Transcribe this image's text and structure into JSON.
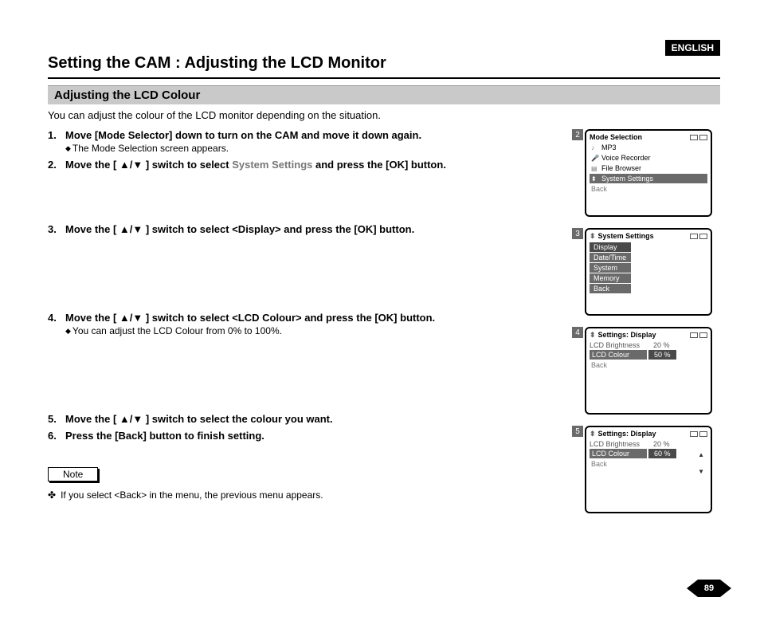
{
  "lang_tag": "ENGLISH",
  "page_title": "Setting the CAM : Adjusting the LCD Monitor",
  "section_title": "Adjusting the LCD Colour",
  "intro": "You can adjust the colour of the LCD monitor depending on the situation.",
  "steps": {
    "s1": {
      "num": "1.",
      "main": "Move [Mode Selector] down to turn on the CAM and move it down again.",
      "sub": "The Mode Selection screen appears."
    },
    "s2": {
      "num": "2.",
      "main_a": "Move the [ ▲/▼ ] switch to select ",
      "main_grey": "System Settings",
      "main_b": " and press the [OK] button."
    },
    "s3": {
      "num": "3.",
      "main": "Move the [ ▲/▼ ] switch to select <Display> and press the [OK] button."
    },
    "s4": {
      "num": "4.",
      "main": "Move the [ ▲/▼ ] switch to select <LCD Colour> and press the [OK] button.",
      "sub": "You can adjust the LCD Colour from 0% to 100%."
    },
    "s5": {
      "num": "5.",
      "main": "Move the [ ▲/▼ ] switch to select the colour you want."
    },
    "s6": {
      "num": "6.",
      "main": "Press the [Back] button to finish setting."
    }
  },
  "note_label": "Note",
  "note_text": "If you select <Back> in the menu, the previous menu appears.",
  "page_number": "89",
  "screens": {
    "scr2": {
      "num": "2",
      "title": "Mode Selection",
      "items": {
        "mp3": "MP3",
        "voice": "Voice Recorder",
        "file": "File Browser",
        "sys": "System Settings"
      },
      "back": "Back"
    },
    "scr3": {
      "num": "3",
      "title": "System Settings",
      "items": {
        "display": "Display",
        "datetime": "Date/Time",
        "system": "System",
        "memory": "Memory",
        "back": "Back"
      }
    },
    "scr4": {
      "num": "4",
      "title": "Settings: Display",
      "brightness_label": "LCD Brightness",
      "brightness_value": "20 %",
      "colour_label": "LCD Colour",
      "colour_value": "50 %",
      "back": "Back"
    },
    "scr5": {
      "num": "5",
      "title": "Settings: Display",
      "brightness_label": "LCD Brightness",
      "brightness_value": "20 %",
      "colour_label": "LCD Colour",
      "colour_value": "60 %",
      "back": "Back"
    }
  }
}
